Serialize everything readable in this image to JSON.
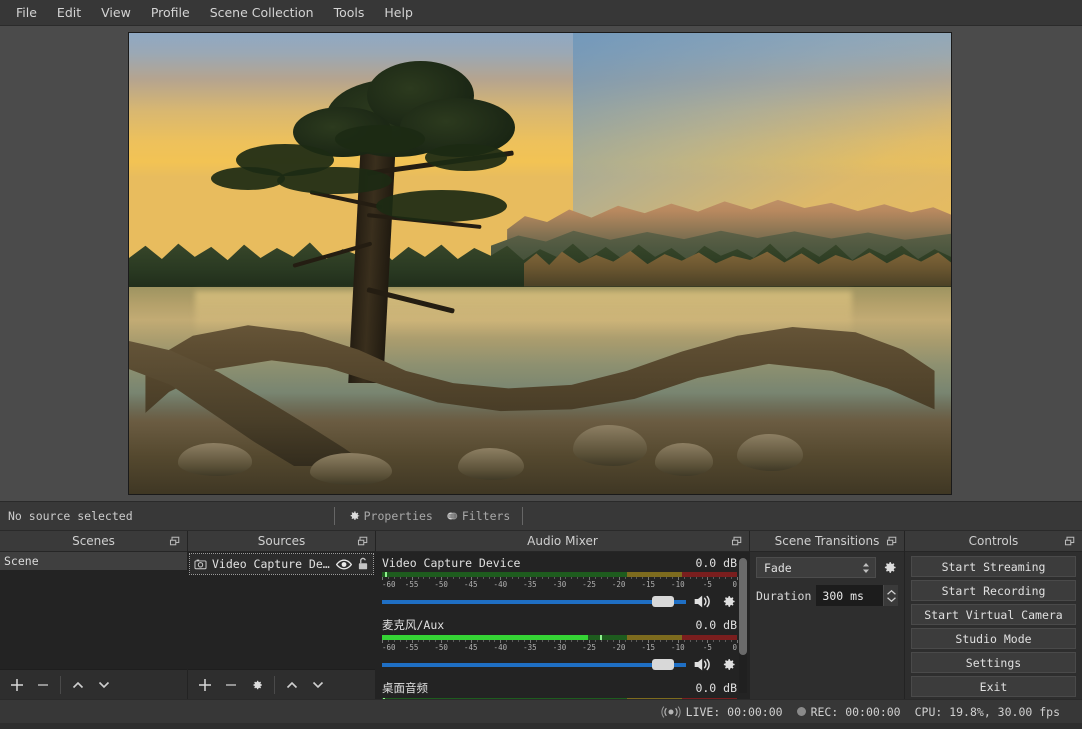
{
  "app": {
    "title": "OBS Studio"
  },
  "menubar": {
    "items": [
      {
        "label": "File",
        "name": "menu-file"
      },
      {
        "label": "Edit",
        "name": "menu-edit"
      },
      {
        "label": "View",
        "name": "menu-view"
      },
      {
        "label": "Profile",
        "name": "menu-profile"
      },
      {
        "label": "Scene Collection",
        "name": "menu-scene-collection"
      },
      {
        "label": "Tools",
        "name": "menu-tools"
      },
      {
        "label": "Help",
        "name": "menu-help"
      }
    ]
  },
  "preview": {
    "scene_description": "Sunset lake landscape with silhouetted pine tree and exposed driftwood roots in foreground",
    "background_color": "#4b4b4b"
  },
  "source_toolbar": {
    "status_label": "No source selected",
    "properties_label": "Properties",
    "filters_label": "Filters"
  },
  "scenes_dock": {
    "title": "Scenes",
    "items": [
      {
        "label": "Scene",
        "selected": true
      }
    ],
    "footer_buttons": [
      {
        "name": "add-scene-button",
        "glyph": "plus"
      },
      {
        "name": "remove-scene-button",
        "glyph": "minus"
      },
      {
        "name": "move-scene-up-button",
        "glyph": "chevron-up"
      },
      {
        "name": "move-scene-down-button",
        "glyph": "chevron-down"
      }
    ]
  },
  "sources_dock": {
    "title": "Sources",
    "items": [
      {
        "label": "Video Capture Devi‹",
        "icon": "camera-icon",
        "visible": true,
        "locked": false,
        "selected": true
      }
    ],
    "footer_buttons": [
      {
        "name": "add-source-button",
        "glyph": "plus"
      },
      {
        "name": "remove-source-button",
        "glyph": "minus"
      },
      {
        "name": "source-properties-button",
        "glyph": "gear"
      },
      {
        "name": "move-source-up-button",
        "glyph": "chevron-up"
      },
      {
        "name": "move-source-down-button",
        "glyph": "chevron-down"
      }
    ]
  },
  "audio_mixer": {
    "title": "Audio Mixer",
    "tick_labels": [
      "-60",
      "-55",
      "-50",
      "-45",
      "-40",
      "-35",
      "-30",
      "-25",
      "-20",
      "-15",
      "-10",
      "-5",
      "0"
    ],
    "channels": [
      {
        "name": "Video Capture Device",
        "db": "0.0 dB",
        "level_percent": 0,
        "peak_percent": 1.5,
        "fader_percent": 96,
        "muted": false
      },
      {
        "name": "麦克风/Aux",
        "db": "0.0 dB",
        "level_percent": 58,
        "peak_percent": 62,
        "fader_percent": 96,
        "muted": false
      },
      {
        "name": "桌面音频",
        "db": "0.0 dB",
        "level_percent": 100,
        "peak_percent": 0,
        "fader_percent": 96,
        "muted": false
      }
    ]
  },
  "scene_transitions": {
    "title": "Scene Transitions",
    "transition_value": "Fade",
    "duration_label": "Duration",
    "duration_value": "300 ms"
  },
  "controls": {
    "title": "Controls",
    "buttons": [
      {
        "label": "Start Streaming",
        "name": "start-streaming-button"
      },
      {
        "label": "Start Recording",
        "name": "start-recording-button"
      },
      {
        "label": "Start Virtual Camera",
        "name": "start-virtual-camera-button"
      },
      {
        "label": "Studio Mode",
        "name": "studio-mode-button"
      },
      {
        "label": "Settings",
        "name": "settings-button"
      },
      {
        "label": "Exit",
        "name": "exit-button"
      }
    ]
  },
  "statusbar": {
    "live_label": "LIVE: 00:00:00",
    "rec_label": "REC: 00:00:00",
    "cpu_label": "CPU: 19.8%,  30.00 fps"
  },
  "colors": {
    "window_bg": "#2e2e2e",
    "panel_bg": "#232323",
    "header_bg": "#3a3a3a",
    "fader_blue": "#1f6fc4",
    "meter_green": "#35d435",
    "meter_yellow": "#d4c235",
    "meter_red": "#e04040"
  }
}
